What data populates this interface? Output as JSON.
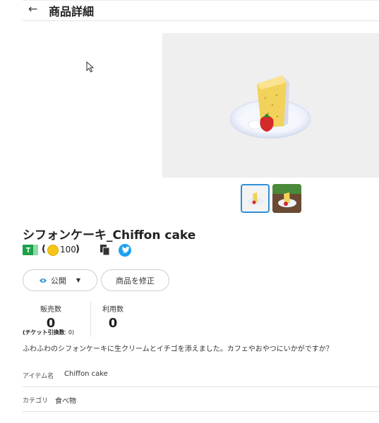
{
  "header": {
    "back_icon": "arrow-left-icon",
    "title": "商品詳細"
  },
  "product": {
    "name": "シフォンケーキ_Chiffon cake",
    "price": "100",
    "paren_open": "(",
    "paren_close": ")",
    "description": "ふわふわのシフォンケーキに生クリームとイチゴを添えました。カフェやおやつにいかがですか？"
  },
  "actions": {
    "visibility_label": "公開",
    "edit_label": "商品を修正"
  },
  "stats": {
    "sales_label": "販売数",
    "sales_value": "0",
    "usage_label": "利用数",
    "usage_value": "0",
    "ticket_note_label": "(チケット引換数",
    "ticket_note_value": ": 0)"
  },
  "attributes": [
    {
      "label": "アイテム名",
      "value": "Chiffon cake"
    },
    {
      "label": "カテゴリ",
      "value": "食べ物"
    }
  ],
  "colors": {
    "accent": "#2f8fd8",
    "twitter": "#1da1f2",
    "coin": "#f5c518",
    "ticket": "#1aa34a"
  }
}
